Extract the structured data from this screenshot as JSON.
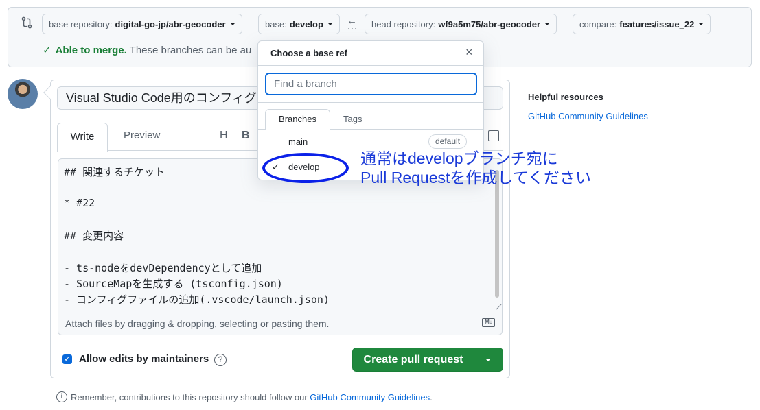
{
  "compare": {
    "base_repo_prefix": "base repository:",
    "base_repo_value": "digital-go-jp/abr-geocoder",
    "base_prefix": "base:",
    "base_value": "develop",
    "head_repo_prefix": "head repository:",
    "head_repo_value": "wf9a5m75/abr-geocoder",
    "compare_prefix": "compare:",
    "compare_value": "features/issue_22",
    "arrow": "←",
    "dots": "···",
    "merge_status": "Able to merge.",
    "merge_text": "These branches can be au"
  },
  "pr": {
    "title": "Visual Studio Code用のコンフィグの",
    "tab_write": "Write",
    "tab_preview": "Preview",
    "tool_heading": "H",
    "tool_bold": "B",
    "body_lines": [
      "## 関連するチケット",
      "",
      "* #22",
      "",
      "## 変更内容",
      "",
      "- ts-nodeをdevDependencyとして追加",
      "- SourceMapを生成する (tsconfig.json)",
      "- コンフィグファイルの追加(.vscode/launch.json)"
    ],
    "attach_text": "Attach files by dragging & dropping, selecting or pasting them.",
    "md_label": "M↓",
    "allow_edits_label": "Allow edits by maintainers",
    "help_glyph": "?",
    "create_button": "Create pull request"
  },
  "footer": {
    "remember_text": "Remember, contributions to this repository should follow our ",
    "remember_link": "GitHub Community Guidelines",
    "remember_end": "."
  },
  "sidebar": {
    "title": "Helpful resources",
    "link": "GitHub Community Guidelines"
  },
  "dropdown": {
    "header": "Choose a base ref",
    "close": "×",
    "filter_placeholder": "Find a branch",
    "tab_branches": "Branches",
    "tab_tags": "Tags",
    "items": [
      {
        "label": "main",
        "badge": "default",
        "selected": false
      },
      {
        "label": "develop",
        "badge": "",
        "selected": true
      }
    ],
    "check": "✓"
  },
  "annotation": {
    "line1": "通常はdevelopブランチ宛に",
    "line2": "Pull Requestを作成してください",
    "color": "#1a3ad8"
  },
  "colors": {
    "primary_green": "#1f883d",
    "link_blue": "#0969da",
    "success_text": "#1a7f37",
    "annotation_ring": "#0b21e8"
  }
}
